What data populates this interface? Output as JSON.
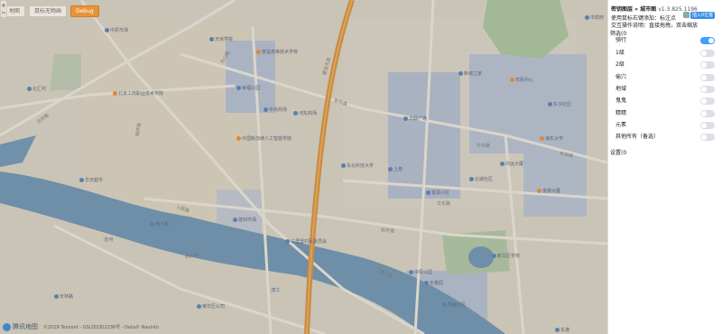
{
  "map": {
    "buttons": [
      "地图",
      "鼠标无物画",
      "Debug"
    ],
    "pois": [
      {
        "text": "中原市场",
        "type": "b"
      },
      {
        "text": "天目学院",
        "type": "b"
      },
      {
        "text": "普益高等技术学校",
        "type": "o"
      },
      {
        "text": "北汇村",
        "type": "b"
      },
      {
        "text": "北京工商职业技术学院",
        "type": "o"
      },
      {
        "text": "幸福公园",
        "type": "b"
      },
      {
        "text": "中央商场",
        "type": "b"
      },
      {
        "text": "中国新加坡人工智能学院",
        "type": "o"
      },
      {
        "text": "河东商场",
        "type": "b"
      },
      {
        "text": "东北科技大学",
        "type": "b"
      },
      {
        "text": "上尊",
        "type": "b"
      },
      {
        "text": "市民中心",
        "type": "o"
      },
      {
        "text": "新城之家",
        "type": "b"
      },
      {
        "text": "华联广场",
        "type": "b"
      },
      {
        "text": "三里堡村民委员会",
        "type": "b"
      },
      {
        "text": "建材市场",
        "type": "b"
      },
      {
        "text": "地下街",
        "type": "b"
      },
      {
        "text": "华天超市",
        "type": "b"
      },
      {
        "text": "海东大学",
        "type": "o"
      },
      {
        "text": "东汉社区",
        "type": "b"
      },
      {
        "text": "市政府",
        "type": "b"
      },
      {
        "text": "北城社区",
        "type": "b"
      },
      {
        "text": "富源小区",
        "type": "b"
      },
      {
        "text": "鸿运大厦",
        "type": "b"
      },
      {
        "text": "金融大厦",
        "type": "o"
      },
      {
        "text": "新华区学校",
        "type": "b"
      },
      {
        "text": "中原公园",
        "type": "b"
      },
      {
        "text": "荣华区公司",
        "type": "b"
      },
      {
        "text": "长林路",
        "type": "b"
      },
      {
        "text": "长春园",
        "type": "b"
      },
      {
        "text": "鸿运小区",
        "type": "b"
      },
      {
        "text": "东港",
        "type": "b"
      }
    ],
    "roads": [
      "东山路",
      "建设大道",
      "新华路",
      "中华路",
      "人民路",
      "滨江路",
      "文化路",
      "南环路",
      "北环路",
      "东风路",
      "和平路",
      "西大街"
    ],
    "water": [
      "汾河",
      "滨江"
    ],
    "logo": "腾讯地图",
    "copyright": "©2019 Tencent - GS(2018)2236号 - Data© NavInfo"
  },
  "panel": {
    "app": "密钥图层",
    "arrow": "»",
    "mode": "城市图",
    "version": "v1.3.825.1196",
    "line2": "使用鼠标右键添加：标注点",
    "line3": "交互操作说明：直接拖拽，双击缩放",
    "sub_btn": "插入0位置",
    "section1": "筛选(0",
    "rows": [
      {
        "label": "骑行",
        "on": true
      },
      {
        "label": "1级",
        "on": false
      },
      {
        "label": "2级",
        "on": false
      },
      {
        "label": "偷穴",
        "on": false
      },
      {
        "label": "地域",
        "on": false
      },
      {
        "label": "鬼鬼",
        "on": false
      },
      {
        "label": "精精",
        "on": false
      },
      {
        "label": "元素",
        "on": false
      },
      {
        "label": "其他所有（备选）",
        "on": false
      }
    ],
    "section2": "设置(0"
  }
}
